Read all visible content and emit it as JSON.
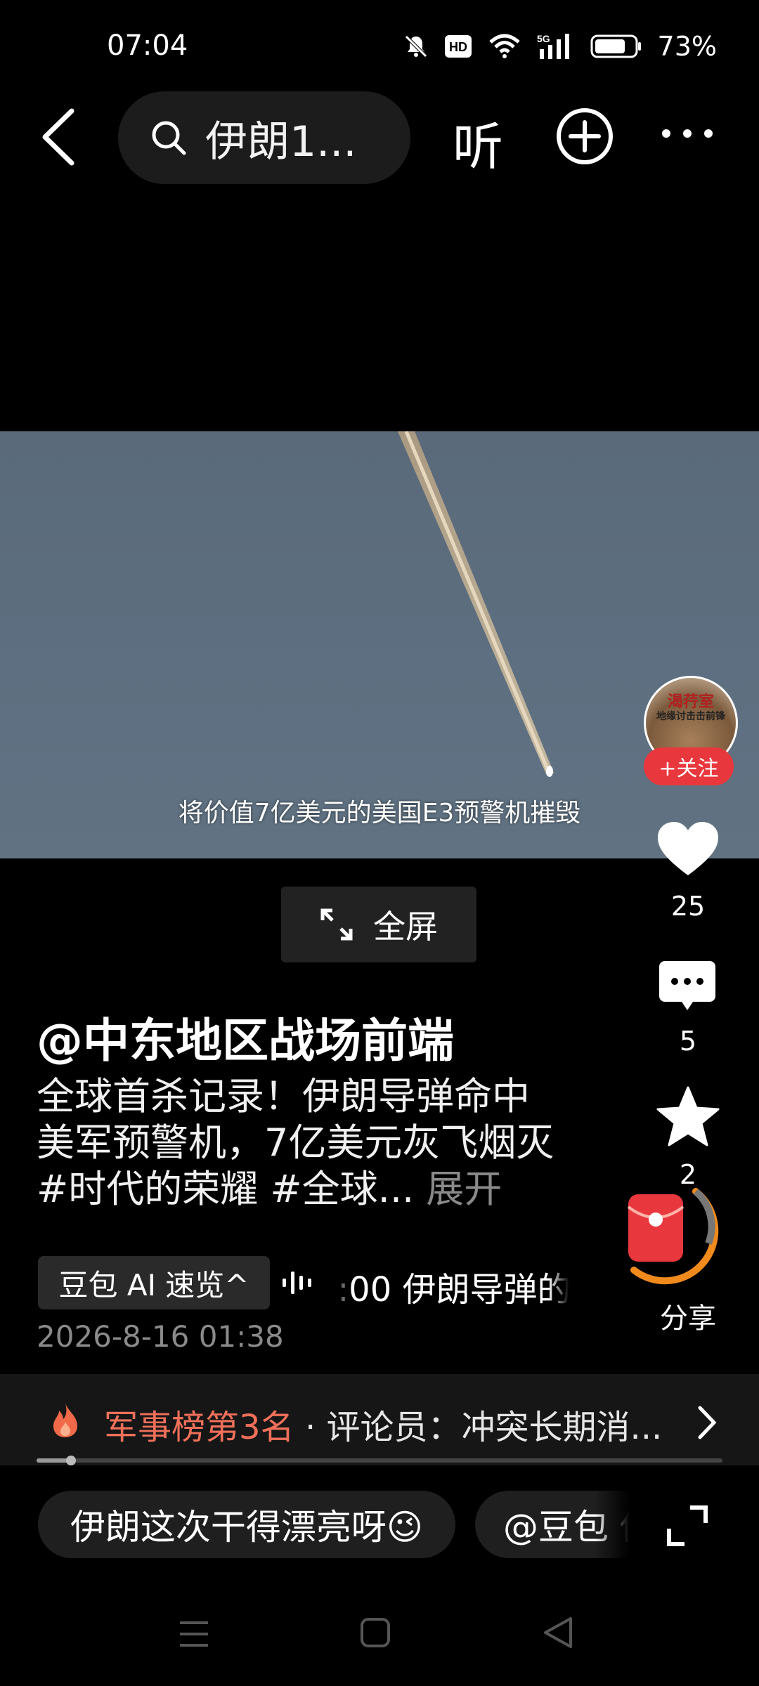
{
  "status_bar": {
    "time": "07:04",
    "battery_percent": "73%",
    "icons": [
      "mute-icon",
      "hd-icon",
      "wifi-icon",
      "5g-signal-icon",
      "battery-icon"
    ]
  },
  "top_bar": {
    "search_text": "伊朗1...",
    "listen_label": "听"
  },
  "video": {
    "subtitle": "将价值7亿美元的美国E3预警机摧毁"
  },
  "fullscreen": {
    "label": "全屏"
  },
  "post": {
    "author": "@中东地区战场前端",
    "caption": "全球首杀记录！伊朗导弹命中美军预警机，7亿美元灰飞烟灭 #时代的荣耀 #全球...",
    "expand_label": "展开",
    "ai_chip_label": "豆包 AI 速览^",
    "ai_summary": ":00 伊朗导弹的",
    "date": "2026-8-16 01:38"
  },
  "rail": {
    "avatar_text_top": "渴荇室",
    "avatar_text_bottom": "地缘讨击击前锋",
    "follow_label": "+关注",
    "like_count": "25",
    "comment_count": "5",
    "star_count": "2",
    "share_label": "分享"
  },
  "rank_bar": {
    "title": "军事榜第3名",
    "text": " · 评论员：冲突长期消..."
  },
  "playback": {
    "progress": 0.05
  },
  "quick_comments": [
    "伊朗这次干得漂亮呀😉",
    "@豆包 你"
  ],
  "colors": {
    "accent_red": "#e8383d",
    "rank_orange": "#f0705a",
    "background": "#000000"
  }
}
